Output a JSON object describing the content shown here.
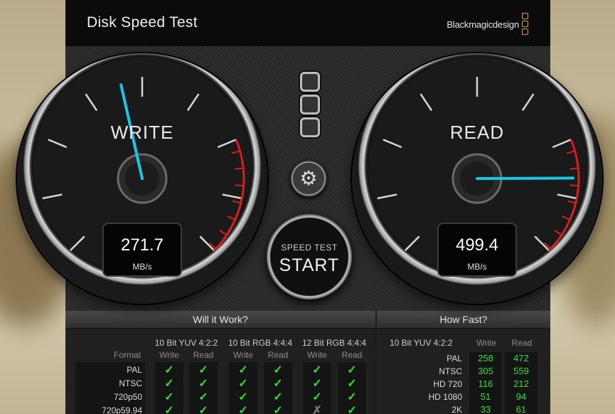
{
  "window": {
    "title": "Disk Speed Test",
    "brand": "Blackmagicdesign",
    "close_icon": "close-icon"
  },
  "write_gauge": {
    "label": "WRITE",
    "value": "271.7",
    "unit": "MB/s"
  },
  "read_gauge": {
    "label": "READ",
    "value": "499.4",
    "unit": "MB/s"
  },
  "controls": {
    "start_top": "SPEED TEST",
    "start_main": "START",
    "settings_icon": "gear-icon"
  },
  "will_it_work": {
    "title": "Will it Work?",
    "format_label": "Format",
    "groups": [
      {
        "name": "10 Bit YUV 4:2:2",
        "write": "Write",
        "read": "Read"
      },
      {
        "name": "10 Bit RGB 4:4:4",
        "write": "Write",
        "read": "Read"
      },
      {
        "name": "12 Bit RGB 4:4:4",
        "write": "Write",
        "read": "Read"
      }
    ],
    "rows": [
      {
        "format": "PAL",
        "marks": [
          "✓",
          "✓",
          "✓",
          "✓",
          "✓",
          "✓"
        ]
      },
      {
        "format": "NTSC",
        "marks": [
          "✓",
          "✓",
          "✓",
          "✓",
          "✓",
          "✓"
        ]
      },
      {
        "format": "720p50",
        "marks": [
          "✓",
          "✓",
          "✓",
          "✓",
          "✓",
          "✓"
        ]
      },
      {
        "format": "720p59.94",
        "marks": [
          "✓",
          "✓",
          "✓",
          "✓",
          "✗",
          "✓"
        ]
      }
    ]
  },
  "how_fast": {
    "title": "How Fast?",
    "group": "10 Bit YUV 4:2:2",
    "write": "Write",
    "read": "Read",
    "rows": [
      {
        "format": "PAL",
        "write": "258",
        "read": "472"
      },
      {
        "format": "NTSC",
        "write": "305",
        "read": "559"
      },
      {
        "format": "HD 720",
        "write": "116",
        "read": "212"
      },
      {
        "format": "HD 1080",
        "write": "51",
        "read": "94"
      },
      {
        "format": "2K",
        "write": "33",
        "read": "61"
      }
    ]
  },
  "colors": {
    "needle": "#19c6e6",
    "accent": "#e3a21a",
    "redline": "#d81e1e",
    "ok": "#2fe02f"
  }
}
